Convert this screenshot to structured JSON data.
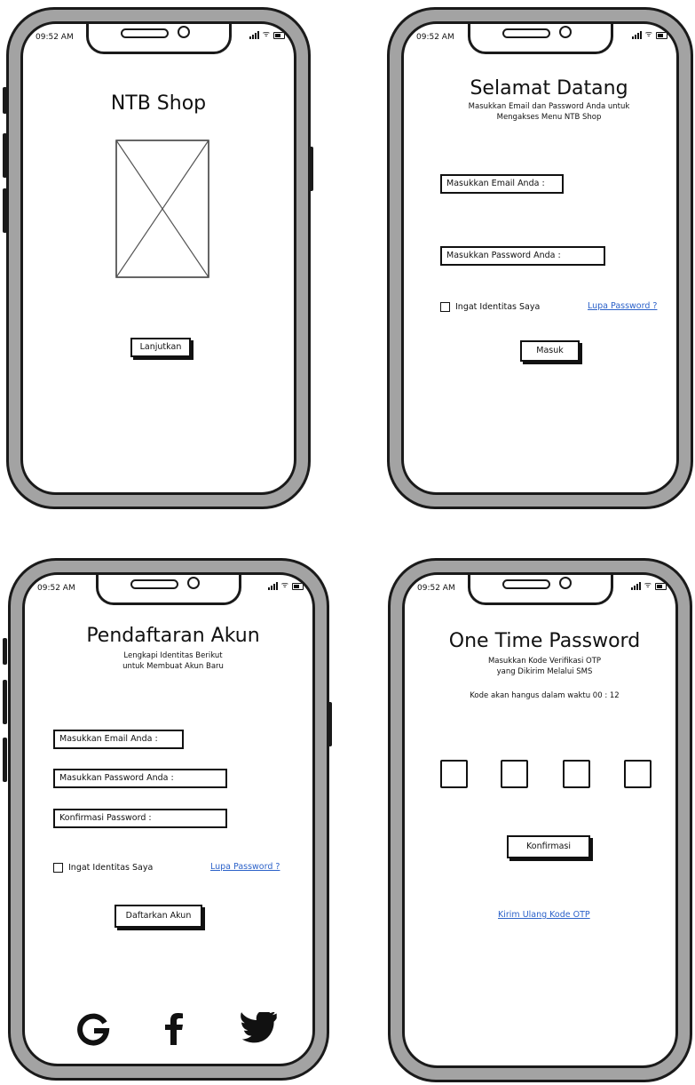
{
  "status_bar": {
    "time": "09:52 AM"
  },
  "splash": {
    "title": "NTB Shop",
    "button": "Lanjutkan"
  },
  "login": {
    "title": "Selamat Datang",
    "subtitle_line1": "Masukkan Email dan Password Anda untuk",
    "subtitle_line2": "Mengakses Menu NTB Shop",
    "email_label": "Masukkan Email Anda :",
    "password_label": "Masukkan Password Anda :",
    "remember": "Ingat Identitas Saya",
    "forgot": "Lupa Password ?",
    "button": "Masuk"
  },
  "register": {
    "title": "Pendaftaran Akun",
    "subtitle_line1": "Lengkapi Identitas Berikut",
    "subtitle_line2": "untuk Membuat Akun Baru",
    "email_label": "Masukkan Email Anda :",
    "password_label": "Masukkan Password Anda :",
    "confirm_label": "Konfirmasi Password :",
    "remember": "Ingat Identitas Saya",
    "forgot": "Lupa Password ?",
    "button": "Daftarkan Akun",
    "social_icons": [
      "google-icon",
      "facebook-icon",
      "twitter-icon"
    ]
  },
  "otp": {
    "title": "One Time Password",
    "subtitle_line1": "Masukkan Kode Verifikasi OTP",
    "subtitle_line2": "yang Dikirim Melalui SMS",
    "timer_text": "Kode akan hangus dalam waktu 00 : 12",
    "button": "Konfirmasi",
    "resend": "Kirim Ulang Kode OTP"
  }
}
